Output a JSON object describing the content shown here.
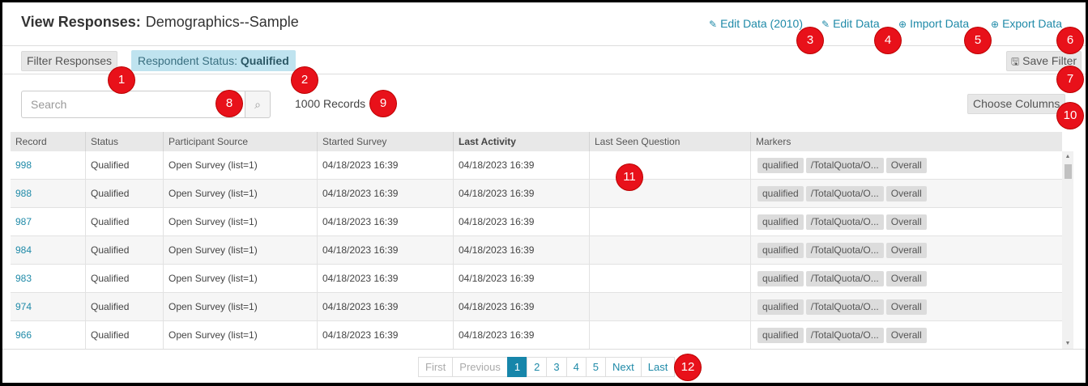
{
  "header": {
    "title_bold": "View Responses:",
    "title_rest": "Demographics--Sample",
    "links": [
      {
        "label": "Edit Data (2010)",
        "icon": "pencil-icon"
      },
      {
        "label": "Edit Data",
        "icon": "pencil-icon"
      },
      {
        "label": "Import Data",
        "icon": "upload-circle-icon"
      },
      {
        "label": "Export Data",
        "icon": "download-circle-icon"
      }
    ]
  },
  "filterbar": {
    "filter_label": "Filter Responses",
    "status_prefix": "Respondent Status:",
    "status_value": "Qualified",
    "save_filter_label": "Save Filter"
  },
  "search": {
    "placeholder": "Search",
    "records_label": "1000 Records",
    "choose_columns_label": "Choose Columns"
  },
  "table": {
    "columns": [
      "Record",
      "Status",
      "Participant Source",
      "Started Survey",
      "Last Activity",
      "Last Seen Question",
      "Markers"
    ],
    "rows": [
      {
        "record": "998",
        "status": "Qualified",
        "source": "Open Survey (list=1)",
        "started": "04/18/2023 16:39",
        "last_activity": "04/18/2023 16:39",
        "last_seen": "",
        "markers": [
          "qualified",
          "/TotalQuota/O...",
          "Overall"
        ]
      },
      {
        "record": "988",
        "status": "Qualified",
        "source": "Open Survey (list=1)",
        "started": "04/18/2023 16:39",
        "last_activity": "04/18/2023 16:39",
        "last_seen": "",
        "markers": [
          "qualified",
          "/TotalQuota/O...",
          "Overall"
        ]
      },
      {
        "record": "987",
        "status": "Qualified",
        "source": "Open Survey (list=1)",
        "started": "04/18/2023 16:39",
        "last_activity": "04/18/2023 16:39",
        "last_seen": "",
        "markers": [
          "qualified",
          "/TotalQuota/O...",
          "Overall"
        ]
      },
      {
        "record": "984",
        "status": "Qualified",
        "source": "Open Survey (list=1)",
        "started": "04/18/2023 16:39",
        "last_activity": "04/18/2023 16:39",
        "last_seen": "",
        "markers": [
          "qualified",
          "/TotalQuota/O...",
          "Overall"
        ]
      },
      {
        "record": "983",
        "status": "Qualified",
        "source": "Open Survey (list=1)",
        "started": "04/18/2023 16:39",
        "last_activity": "04/18/2023 16:39",
        "last_seen": "",
        "markers": [
          "qualified",
          "/TotalQuota/O...",
          "Overall"
        ]
      },
      {
        "record": "974",
        "status": "Qualified",
        "source": "Open Survey (list=1)",
        "started": "04/18/2023 16:39",
        "last_activity": "04/18/2023 16:39",
        "last_seen": "",
        "markers": [
          "qualified",
          "/TotalQuota/O...",
          "Overall"
        ]
      },
      {
        "record": "966",
        "status": "Qualified",
        "source": "Open Survey (list=1)",
        "started": "04/18/2023 16:39",
        "last_activity": "04/18/2023 16:39",
        "last_seen": "",
        "markers": [
          "qualified",
          "/TotalQuota/O...",
          "Overall"
        ]
      }
    ]
  },
  "pagination": {
    "first": "First",
    "previous": "Previous",
    "pages": [
      "1",
      "2",
      "3",
      "4",
      "5"
    ],
    "active_page": "1",
    "next": "Next",
    "last": "Last"
  },
  "callouts": [
    "1",
    "2",
    "3",
    "4",
    "5",
    "6",
    "7",
    "8",
    "9",
    "10",
    "11",
    "12"
  ],
  "colors": {
    "accent": "#1f8aa8",
    "active_page": "#1786aa",
    "callout": "#e8111a",
    "status_chip": "#bfe3ef"
  }
}
